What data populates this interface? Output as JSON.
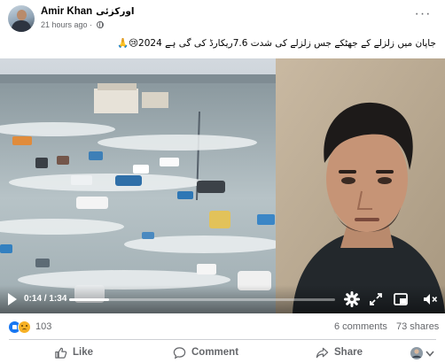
{
  "post": {
    "author_name": "Amir Khan",
    "author_alt_name": "اورکزئی",
    "timestamp": "21 hours ago",
    "separator": "·",
    "more_label": "···",
    "caption": "جاپان میں زلزلے کے جھٹکے جس زلزلے کی شدت 7.6ریکارڈ کی گی ہے 2024😢🙏"
  },
  "video": {
    "current_time": "0:14",
    "duration": "1:34",
    "time_separator": "/",
    "progress_fraction": 0.149
  },
  "stats": {
    "reaction_count": "103",
    "comments": "6 comments",
    "shares": "73 shares",
    "reactions": [
      "like",
      "sad"
    ]
  },
  "actions": {
    "like_label": "Like",
    "comment_label": "Comment",
    "share_label": "Share"
  },
  "icons": {
    "play": "play-icon",
    "settings": "gear-icon",
    "fullscreen": "fullscreen-icon",
    "pip": "picture-in-picture-icon",
    "volume": "volume-icon",
    "like": "thumbs-up-icon",
    "comment": "comment-bubble-icon",
    "share": "share-arrow-icon",
    "globe": "globe-icon"
  },
  "colors": {
    "brand": "#1877f2",
    "secondary_text": "#65676b",
    "divider": "#ced0d4"
  }
}
